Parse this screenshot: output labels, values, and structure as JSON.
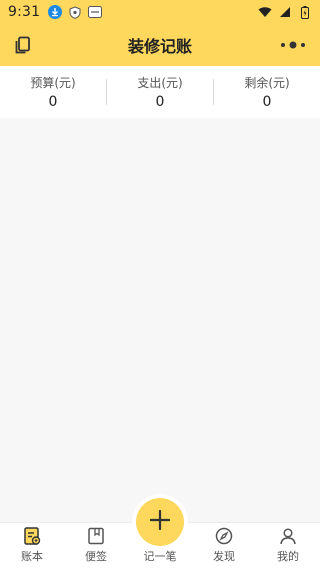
{
  "status_bar": {
    "time": "9:31",
    "icons": [
      "download-icon",
      "shield-icon",
      "notification-badge-icon",
      "wifi-icon",
      "signal-icon",
      "battery-icon"
    ]
  },
  "header": {
    "title": "装修记账",
    "left_icon": "copy-icon",
    "right_icon": "more-dots-icon"
  },
  "summary": {
    "budget_label": "预算(元)",
    "budget_value": "0",
    "expense_label": "支出(元)",
    "expense_value": "0",
    "remaining_label": "剩余(元)",
    "remaining_value": "0"
  },
  "tabs": [
    {
      "label": "账本",
      "icon": "ledger-icon"
    },
    {
      "label": "便签",
      "icon": "note-icon"
    },
    {
      "label": "记一笔",
      "icon": "plus-icon"
    },
    {
      "label": "发现",
      "icon": "compass-icon"
    },
    {
      "label": "我的",
      "icon": "person-icon"
    }
  ],
  "colors": {
    "accent": "#fdd85d",
    "background": "#f7f7f7"
  }
}
